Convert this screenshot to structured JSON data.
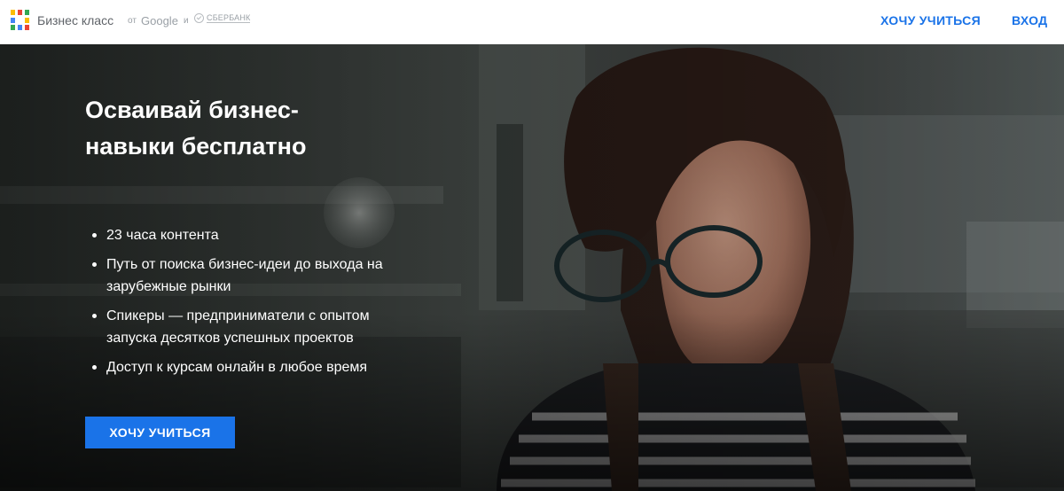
{
  "header": {
    "brand_name": "Бизнес класс",
    "brand_from": "от",
    "brand_google": "Google",
    "brand_and": "и",
    "brand_sber": "СБЕРБАНК",
    "logo_colors": [
      "#fbbc04",
      "#ea4335",
      "#34a853",
      "#4285f4",
      "#fbbc04",
      "#ea4335",
      "#34a853",
      "#4285f4",
      "#fbbc04"
    ],
    "nav": {
      "learn_label": "ХОЧУ УЧИТЬСЯ",
      "login_label": "ВХОД"
    }
  },
  "hero": {
    "title": "Осваивай бизнес-навыки бесплатно",
    "features": [
      "23 часа контента",
      "Путь от поиска бизнес-идеи до выхода на зарубежные рынки",
      "Спикеры — предприниматели с опытом запуска десятков успешных проектов",
      "Доступ к курсам онлайн в любое время"
    ],
    "cta_label": "ХОЧУ УЧИТЬСЯ",
    "image_subject": "woman-in-glasses-kitchen-photo"
  },
  "colors": {
    "accent": "#1a73e8",
    "header_bg": "#ffffff",
    "hero_text": "#ffffff"
  }
}
